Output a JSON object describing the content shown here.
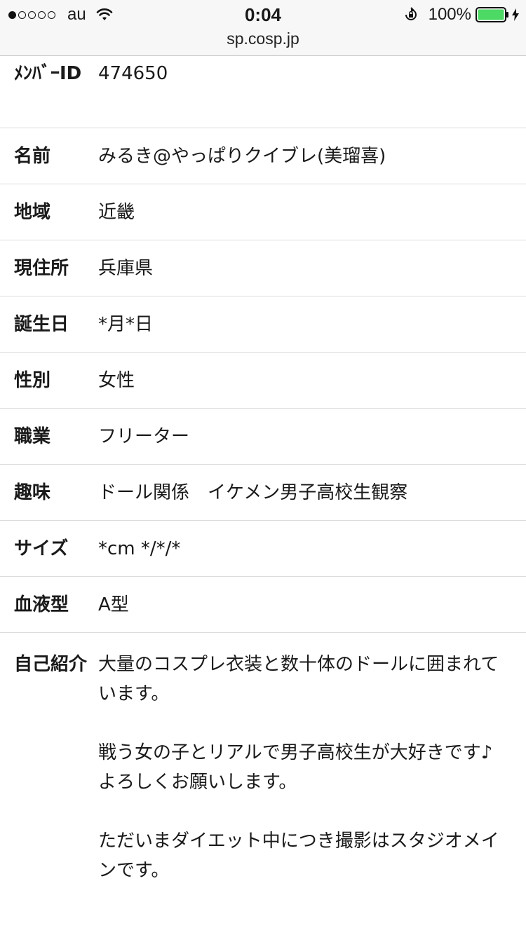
{
  "status_bar": {
    "carrier": "au",
    "time": "0:04",
    "battery_percent": "100%",
    "url": "sp.cosp.jp",
    "signal_bars_filled": 1,
    "signal_bars_total": 5,
    "battery_color": "#4cd964"
  },
  "profile": {
    "rows": [
      {
        "label": "ﾒﾝﾊﾞｰID",
        "value": "474650"
      },
      {
        "label": "名前",
        "value": "みるき@やっぱりクイブレ(美瑠喜)"
      },
      {
        "label": "地域",
        "value": "近畿"
      },
      {
        "label": "現住所",
        "value": "兵庫県"
      },
      {
        "label": "誕生日",
        "value": "*月*日"
      },
      {
        "label": "性別",
        "value": "女性"
      },
      {
        "label": "職業",
        "value": "フリーター"
      },
      {
        "label": "趣味",
        "value": "ドール関係　イケメン男子高校生観察"
      },
      {
        "label": "サイズ",
        "value": "*cm */*/*"
      },
      {
        "label": "血液型",
        "value": "A型"
      }
    ],
    "intro": {
      "label": "自己紹介",
      "value": "大量のコスプレ衣装と数十体のドールに囲まれています。\n\n戦う女の子とリアルで男子高校生が大好きです♪\nよろしくお願いします。\n\nただいまダイエット中につき撮影はスタジオメインです。"
    }
  }
}
